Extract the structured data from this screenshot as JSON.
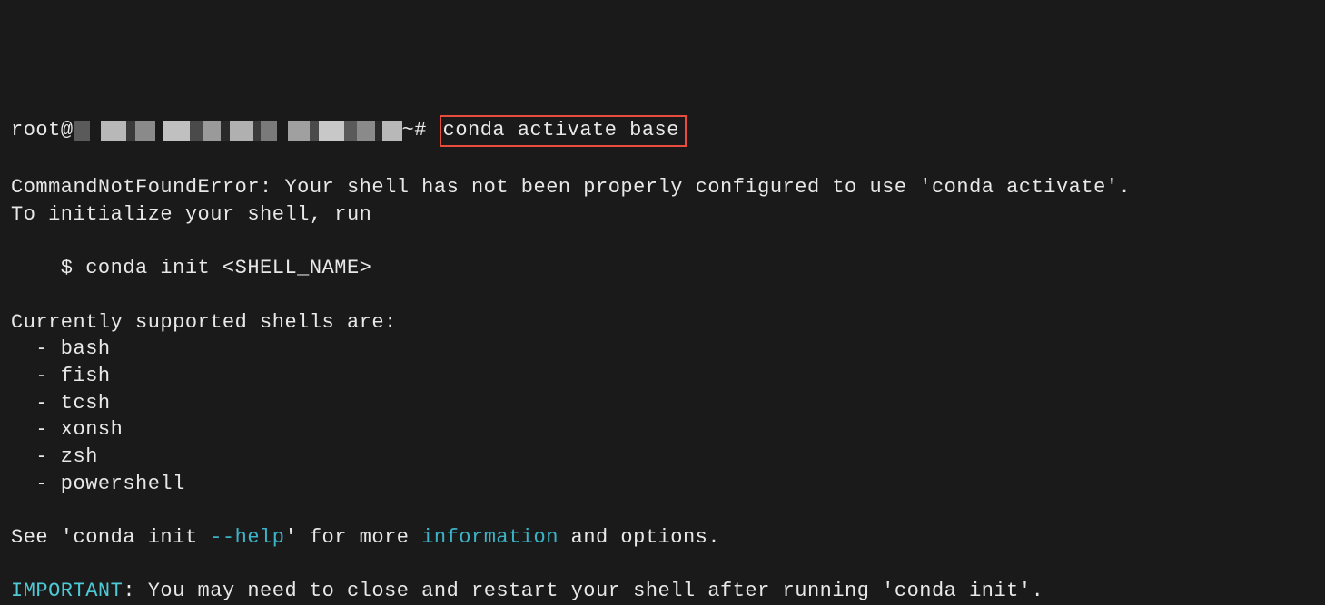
{
  "prompt": {
    "user": "root",
    "at": "@",
    "host_obscured": true,
    "suffix": "~#",
    "command": "conda activate base"
  },
  "error": {
    "line1": "CommandNotFoundError: Your shell has not been properly configured to use 'conda activate'.",
    "line2": "To initialize your shell, run",
    "init_cmd": "    $ conda init <SHELL_NAME>",
    "shells_header": "Currently supported shells are:",
    "shells": [
      "  - bash",
      "  - fish",
      "  - tcsh",
      "  - xonsh",
      "  - zsh",
      "  - powershell"
    ],
    "see_prefix": "See 'conda init ",
    "see_help": "--help",
    "see_mid": "' for more ",
    "see_info": "information",
    "see_suffix": " and options.",
    "important_label": "IMPORTANT",
    "important_text": ": You may need to close and restart your shell after running 'conda init'."
  }
}
